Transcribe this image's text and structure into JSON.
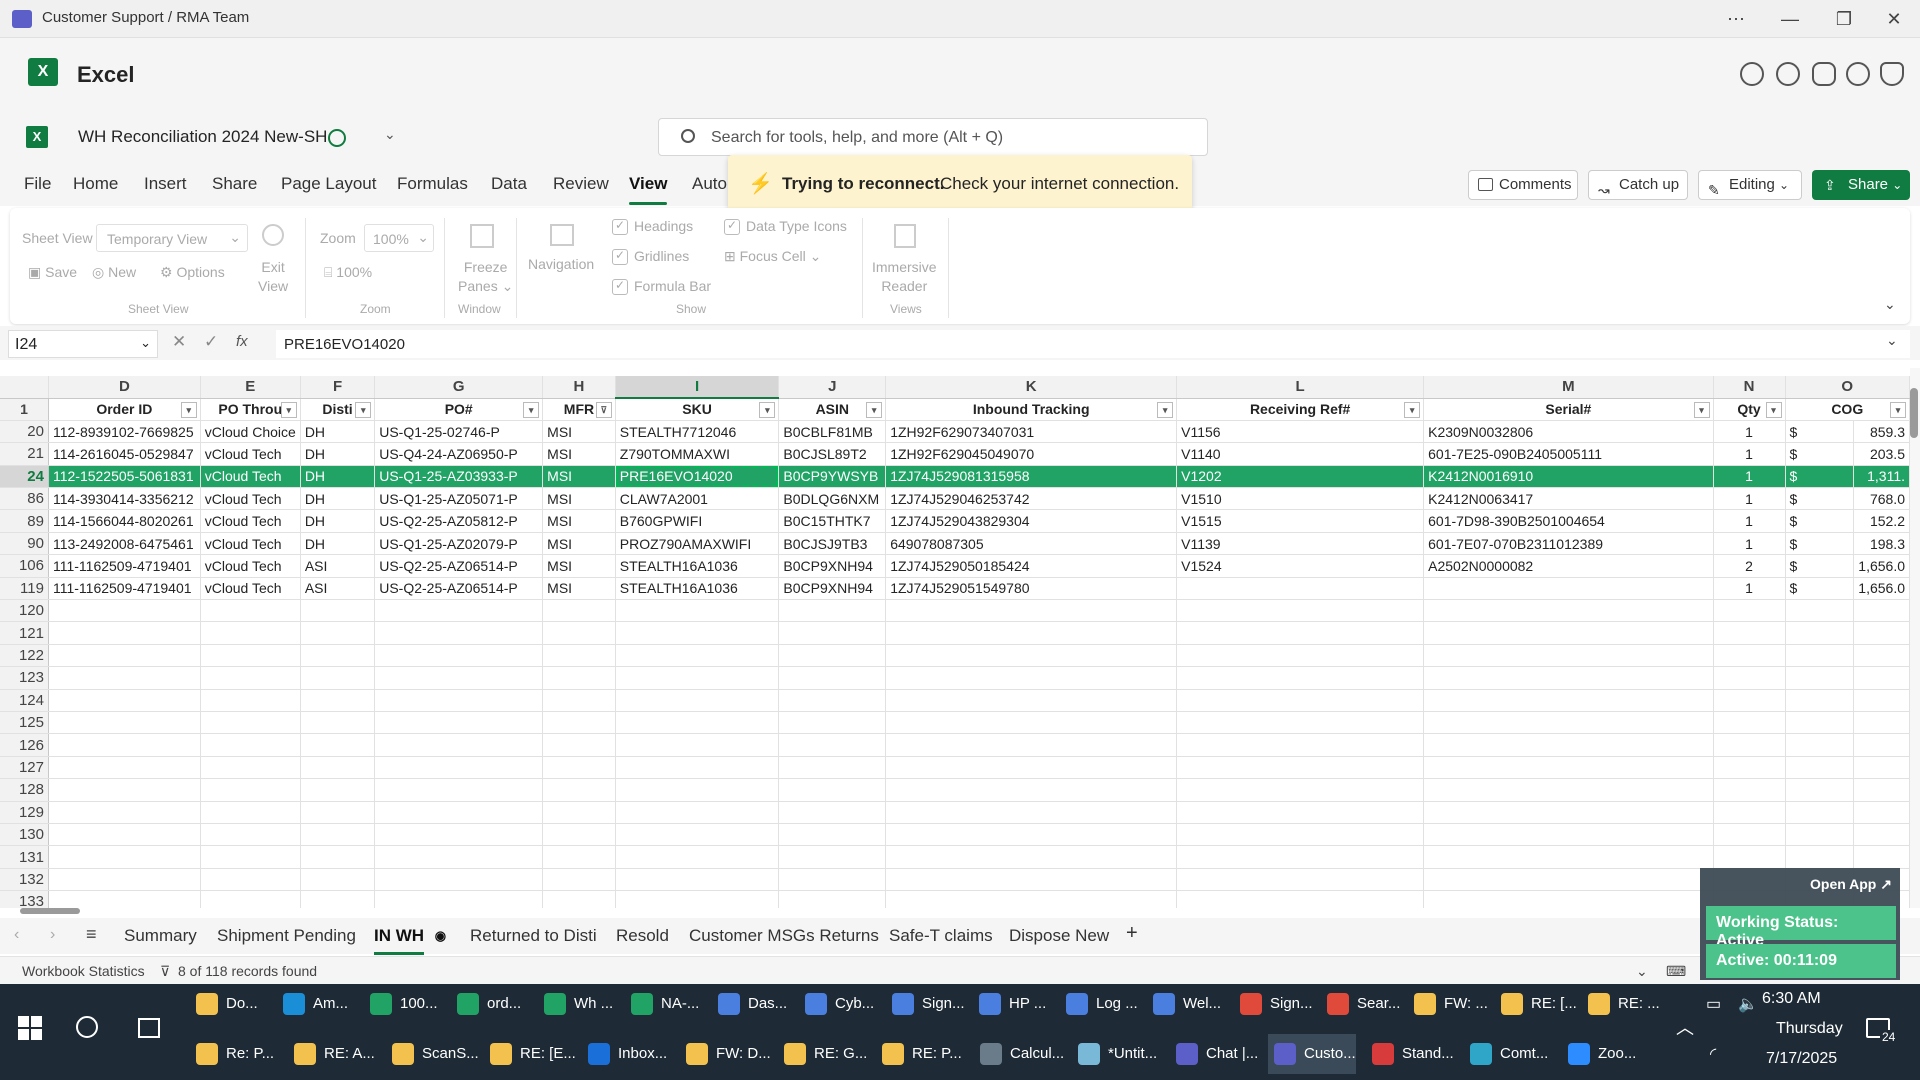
{
  "window": {
    "title": "Customer Support / RMA Team"
  },
  "app": {
    "name": "Excel"
  },
  "doc": {
    "name": "WH Reconciliation 2024 New-SH"
  },
  "search": {
    "placeholder": "Search for tools, help, and more (Alt + Q)"
  },
  "menu": [
    "File",
    "Home",
    "Insert",
    "Share",
    "Page Layout",
    "Formulas",
    "Data",
    "Review",
    "View",
    "Auto"
  ],
  "menu_active": "View",
  "toast": {
    "title": "Trying to reconnect.",
    "message": "Check your internet connection."
  },
  "top_buttons": {
    "comments": "Comments",
    "catchup": "Catch up",
    "editing": "Editing",
    "share": "Share"
  },
  "ribbon": {
    "sheet_view_label": "Sheet View",
    "sheet_view_value": "Temporary View",
    "save": "Save",
    "new": "New",
    "options": "Options",
    "exit_view_1": "Exit",
    "exit_view_2": "View",
    "group_sheet_view": "Sheet View",
    "zoom_label": "Zoom",
    "zoom_value": "100%",
    "zoom_100": "100%",
    "group_zoom": "Zoom",
    "freeze_1": "Freeze",
    "freeze_2": "Panes",
    "navigation": "Navigation",
    "group_window": "Window",
    "headings": "Headings",
    "gridlines": "Gridlines",
    "formula_bar": "Formula Bar",
    "data_type_icons": "Data Type Icons",
    "focus_cell": "Focus Cell",
    "group_show": "Show",
    "immersive_1": "Immersive",
    "immersive_2": "Reader",
    "group_views": "Views"
  },
  "formula_bar": {
    "name_box": "I24",
    "fx": "fx",
    "value": "PRE16EVO14020"
  },
  "columns": [
    "D",
    "E",
    "F",
    "G",
    "H",
    "I",
    "J",
    "K",
    "L",
    "M",
    "N",
    "O"
  ],
  "headers": [
    "Order ID",
    "PO Throu",
    "Disti",
    "PO#",
    "MFR",
    "SKU",
    "ASIN",
    "Inbound Tracking",
    "Receiving Ref#",
    "Serial#",
    "Qty",
    "COG"
  ],
  "rows": [
    {
      "n": "20",
      "cells": [
        "112-8939102-7669825",
        "vCloud Choice",
        "DH",
        "US-Q1-25-02746-P",
        "MSI",
        "STEALTH7712046",
        "B0CBLF81MB",
        "1ZH92F629073407031",
        "V1156",
        "K2309N0032806",
        "1",
        "$",
        "859.3"
      ]
    },
    {
      "n": "21",
      "cells": [
        "114-2616045-0529847",
        "vCloud Tech",
        "DH",
        "US-Q4-24-AZ06950-P",
        "MSI",
        "Z790TOMMAXWI",
        "B0CJSL89T2",
        "1ZH92F629045049070",
        "V1140",
        "601-7E25-090B2405005111",
        "1",
        "$",
        "203.5"
      ]
    },
    {
      "n": "24",
      "cells": [
        "112-1522505-5061831",
        "vCloud Tech",
        "DH",
        "US-Q1-25-AZ03933-P",
        "MSI",
        "PRE16EVO14020",
        "B0CP9YWSYB",
        "1ZJ74J529081315958",
        "V1202",
        "K2412N0016910",
        "1",
        "$",
        "1,311."
      ],
      "selected": true
    },
    {
      "n": "86",
      "cells": [
        "114-3930414-3356212",
        "vCloud Tech",
        "DH",
        "US-Q1-25-AZ05071-P",
        "MSI",
        "CLAW7A2001",
        "B0DLQG6NXM",
        "1ZJ74J529046253742",
        "V1510",
        "K2412N0063417",
        "1",
        "$",
        "768.0"
      ]
    },
    {
      "n": "89",
      "cells": [
        "114-1566044-8020261",
        "vCloud Tech",
        "DH",
        "US-Q2-25-AZ05812-P",
        "MSI",
        "B760GPWIFI",
        "B0C15THTK7",
        "1ZJ74J529043829304",
        "V1515",
        "601-7D98-390B2501004654",
        "1",
        "$",
        "152.2"
      ]
    },
    {
      "n": "90",
      "cells": [
        "113-2492008-6475461",
        "vCloud Tech",
        "DH",
        "US-Q1-25-AZ02079-P",
        "MSI",
        "PROZ790AMAXWIFI",
        "B0CJSJ9TB3",
        "649078087305",
        "V1139",
        "601-7E07-070B2311012389",
        "1",
        "$",
        "198.3"
      ]
    },
    {
      "n": "106",
      "cells": [
        "111-1162509-4719401",
        "vCloud Tech",
        "ASI",
        "US-Q2-25-AZ06514-P",
        "MSI",
        "STEALTH16A1036",
        "B0CP9XNH94",
        "1ZJ74J529050185424",
        "V1524",
        "A2502N0000082",
        "2",
        "$",
        "1,656.0"
      ]
    },
    {
      "n": "119",
      "cells": [
        "111-1162509-4719401",
        "vCloud Tech",
        "ASI",
        "US-Q2-25-AZ06514-P",
        "MSI",
        "STEALTH16A1036",
        "B0CP9XNH94",
        "1ZJ74J529051549780",
        "",
        "",
        "1",
        "$",
        "1,656.0"
      ]
    }
  ],
  "empty_rows": [
    "120",
    "121",
    "122",
    "123",
    "124",
    "125",
    "126",
    "127",
    "128",
    "129",
    "130",
    "131",
    "132",
    "133"
  ],
  "sheet_tabs": [
    "Summary",
    "Shipment Pending",
    "IN WH",
    "Returned to Disti",
    "Resold",
    "Customer MSGs Returns",
    "Safe-T claims",
    "Dispose New"
  ],
  "sheet_tab_active": "IN WH",
  "status": {
    "stats": "Workbook Statistics",
    "filter": "8 of 118 records found"
  },
  "widget": {
    "open_app": "Open App ↗",
    "working_status": "Working Status: Active",
    "active_time": "Active: 00:11:09"
  },
  "taskbar": {
    "row1": [
      {
        "label": "Do...",
        "color": "#f2c14e"
      },
      {
        "label": "Am...",
        "color": "#1a8fd8"
      },
      {
        "label": "100...",
        "color": "#21a366"
      },
      {
        "label": "ord...",
        "color": "#21a366"
      },
      {
        "label": "Wh ...",
        "color": "#21a366"
      },
      {
        "label": "NA-...",
        "color": "#21a366"
      },
      {
        "label": "Das...",
        "color": "#4a7fe0"
      },
      {
        "label": "Cyb...",
        "color": "#4a7fe0"
      },
      {
        "label": "Sign...",
        "color": "#4a7fe0"
      },
      {
        "label": "HP ...",
        "color": "#4a7fe0"
      },
      {
        "label": "Log ...",
        "color": "#4a7fe0"
      },
      {
        "label": "Wel...",
        "color": "#4a7fe0"
      },
      {
        "label": "Sign...",
        "color": "#e04a3a"
      },
      {
        "label": "Sear...",
        "color": "#e04a3a"
      },
      {
        "label": "FW: ...",
        "color": "#f2c14e"
      },
      {
        "label": "RE: [...",
        "color": "#f2c14e"
      },
      {
        "label": "RE: ...",
        "color": "#f2c14e"
      }
    ],
    "row2": [
      {
        "label": "Re: P...",
        "color": "#f2c14e"
      },
      {
        "label": "RE: A...",
        "color": "#f2c14e"
      },
      {
        "label": "ScanS...",
        "color": "#f2c14e"
      },
      {
        "label": "RE: [E...",
        "color": "#f2c14e"
      },
      {
        "label": "Inbox...",
        "color": "#1a6fd8"
      },
      {
        "label": "FW: D...",
        "color": "#f2c14e"
      },
      {
        "label": "RE: G...",
        "color": "#f2c14e"
      },
      {
        "label": "RE: P...",
        "color": "#f2c14e"
      },
      {
        "label": "Calcul...",
        "color": "#6a7b8a"
      },
      {
        "label": "*Untit...",
        "color": "#7ab8d8"
      },
      {
        "label": "Chat |...",
        "color": "#5b5fc7"
      },
      {
        "label": "Custo...",
        "color": "#5b5fc7"
      },
      {
        "label": "Stand...",
        "color": "#d83b3b"
      },
      {
        "label": "Comt...",
        "color": "#2fa6c8"
      },
      {
        "label": "Zoo...",
        "color": "#2d8cff"
      }
    ],
    "time": "6:30 AM",
    "day": "Thursday",
    "date": "7/17/2025",
    "notif_count": "24"
  }
}
